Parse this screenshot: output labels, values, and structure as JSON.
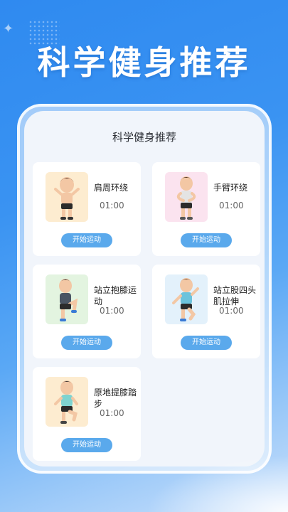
{
  "hero": {
    "title": "科学健身推荐"
  },
  "panel": {
    "title": "科学健身推荐"
  },
  "colors": {
    "accent": "#5aa9ec",
    "bg_top": "#2f8af0"
  },
  "exercises": [
    {
      "name": "肩周环绕",
      "time": "01:00",
      "button": "开始运动",
      "thumb_bg": "#fdecd0",
      "icon": "figure-shoulder-roll-icon"
    },
    {
      "name": "手臂环绕",
      "time": "01:00",
      "button": "开始运动",
      "thumb_bg": "#fbe3ef",
      "icon": "figure-arm-circle-icon"
    },
    {
      "name": "站立抱膝运动",
      "time": "01:00",
      "button": "开始运动",
      "thumb_bg": "#e3f4e0",
      "icon": "figure-knee-hug-icon"
    },
    {
      "name": "站立股四头肌拉伸",
      "time": "01:00",
      "button": "开始运动",
      "thumb_bg": "#e3f1fb",
      "icon": "figure-quad-stretch-icon"
    },
    {
      "name": "原地提膝踏步",
      "time": "01:00",
      "button": "开始运动",
      "thumb_bg": "#fdecd0",
      "icon": "figure-high-knee-icon"
    }
  ]
}
